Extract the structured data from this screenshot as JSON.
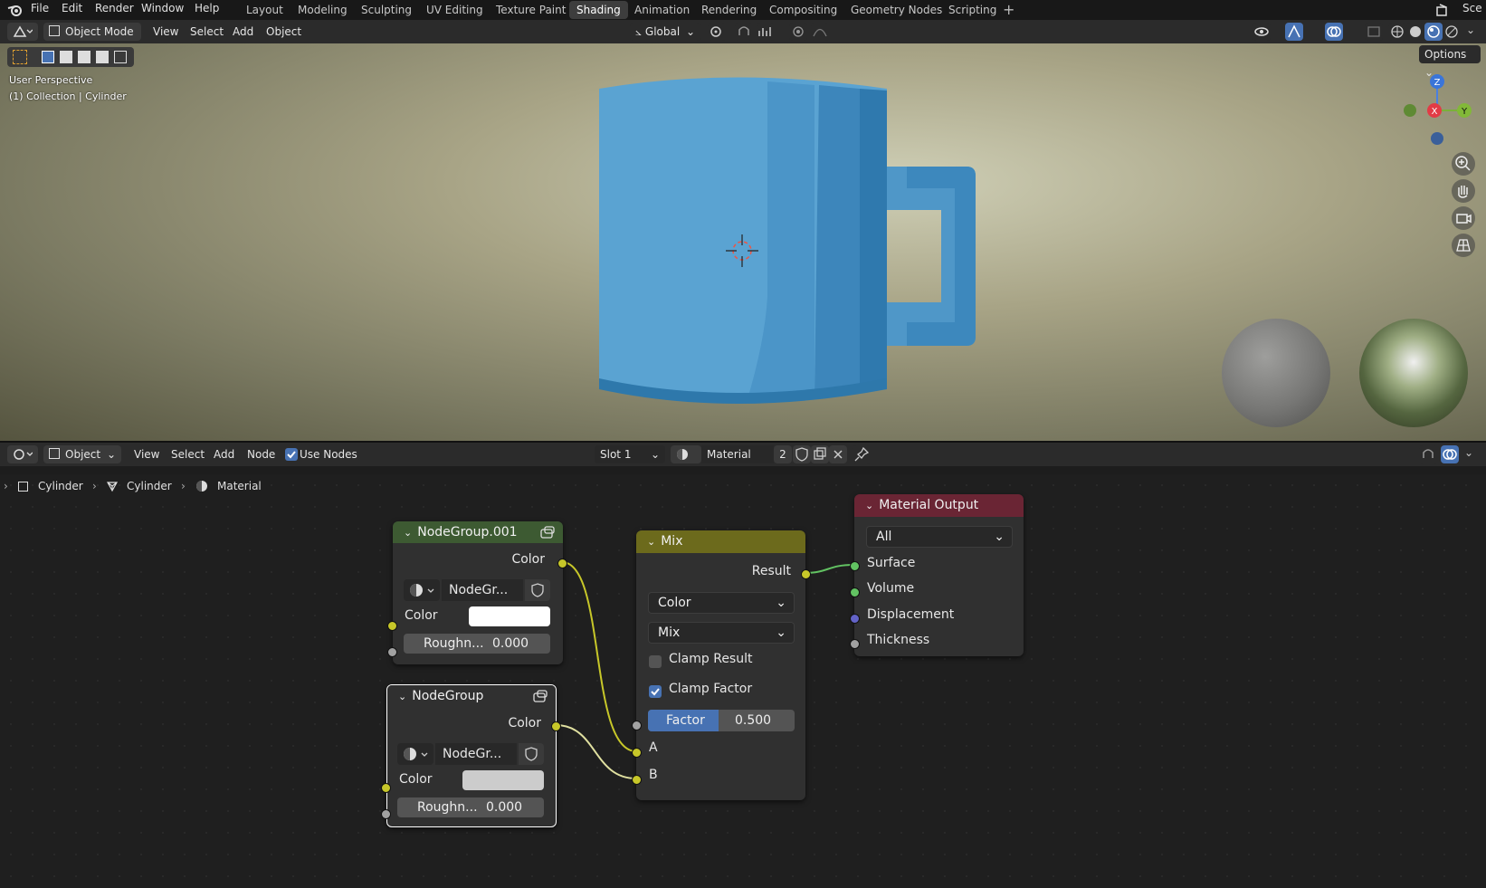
{
  "menus": [
    "File",
    "Edit",
    "Render",
    "Window",
    "Help"
  ],
  "workspaces": [
    "Layout",
    "Modeling",
    "Sculpting",
    "UV Editing",
    "Texture Paint",
    "Shading",
    "Animation",
    "Rendering",
    "Compositing",
    "Geometry Nodes",
    "Scripting"
  ],
  "active_workspace": "Shading",
  "scene_label": "Sce",
  "viewport_header": {
    "mode": "Object Mode",
    "menus": [
      "View",
      "Select",
      "Add",
      "Object"
    ],
    "transform": "Global",
    "options": "Options"
  },
  "viewport": {
    "perspective": "User Perspective",
    "collection": "(1) Collection | Cylinder",
    "gizmo": {
      "z": "Z",
      "x": "X",
      "y": "Y"
    },
    "mug_color": "#5aa3d2"
  },
  "node_header": {
    "mode": "Object",
    "menus": [
      "View",
      "Select",
      "Add",
      "Node"
    ],
    "use_nodes": "Use Nodes",
    "slot": "Slot 1",
    "material": "Material",
    "users": "2"
  },
  "breadcrumb": [
    "Cylinder",
    "Cylinder",
    "Material"
  ],
  "nodes": {
    "group001": {
      "title": "NodeGroup.001",
      "output": "Color",
      "group_name": "NodeGr...",
      "color_label": "Color",
      "rough_label": "Roughn...",
      "rough_value": "0.000"
    },
    "group": {
      "title": "NodeGroup",
      "output": "Color",
      "group_name": "NodeGr...",
      "color_label": "Color",
      "rough_label": "Roughn...",
      "rough_value": "0.000"
    },
    "mix": {
      "title": "Mix",
      "output": "Result",
      "type": "Color",
      "blend": "Mix",
      "clamp_result": "Clamp Result",
      "clamp_factor": "Clamp Factor",
      "factor_label": "Factor",
      "factor_value": "0.500",
      "input_a": "A",
      "input_b": "B"
    },
    "output": {
      "title": "Material Output",
      "target": "All",
      "inputs": [
        "Surface",
        "Volume",
        "Displacement",
        "Thickness"
      ]
    }
  },
  "colors": {
    "group_header": "#3d5a32",
    "mix_header": "#6c6a1c",
    "output_header": "#6a2534",
    "socket_color": "#c7c729",
    "socket_shader": "#62c262",
    "socket_vector": "#6363c7",
    "socket_float": "#a1a1a1"
  }
}
